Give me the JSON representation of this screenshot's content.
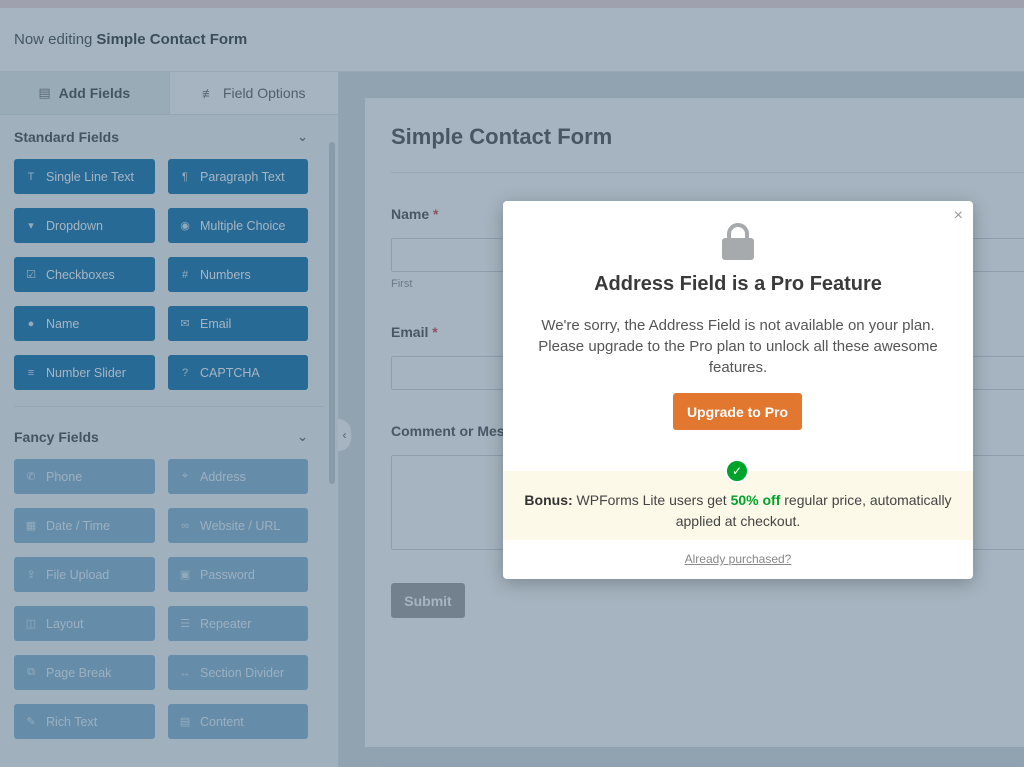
{
  "header": {
    "prefix": "Now editing",
    "form_name": "Simple Contact Form"
  },
  "tabs": [
    {
      "label": "Add Fields",
      "icon": "list-icon"
    },
    {
      "label": "Field Options",
      "icon": "sliders-icon"
    }
  ],
  "standard": {
    "title": "Standard Fields",
    "items": [
      {
        "label": "Single Line Text",
        "icon": "text-icon",
        "glyph": "T"
      },
      {
        "label": "Paragraph Text",
        "icon": "paragraph-icon",
        "glyph": "¶"
      },
      {
        "label": "Dropdown",
        "icon": "dropdown-icon",
        "glyph": "▾"
      },
      {
        "label": "Multiple Choice",
        "icon": "radio-icon",
        "glyph": "◉"
      },
      {
        "label": "Checkboxes",
        "icon": "checkbox-icon",
        "glyph": "☑"
      },
      {
        "label": "Numbers",
        "icon": "hash-icon",
        "glyph": "#"
      },
      {
        "label": "Name",
        "icon": "user-icon",
        "glyph": "●"
      },
      {
        "label": "Email",
        "icon": "envelope-icon",
        "glyph": "✉"
      },
      {
        "label": "Number Slider",
        "icon": "sliders-icon",
        "glyph": "≡"
      },
      {
        "label": "CAPTCHA",
        "icon": "question-icon",
        "glyph": "?"
      }
    ]
  },
  "fancy": {
    "title": "Fancy Fields",
    "items": [
      {
        "label": "Phone",
        "icon": "phone-icon",
        "glyph": "✆"
      },
      {
        "label": "Address",
        "icon": "map-pin-icon",
        "glyph": "⌖"
      },
      {
        "label": "Date / Time",
        "icon": "calendar-icon",
        "glyph": "▦"
      },
      {
        "label": "Website / URL",
        "icon": "link-icon",
        "glyph": "∞"
      },
      {
        "label": "File Upload",
        "icon": "upload-icon",
        "glyph": "⇪"
      },
      {
        "label": "Password",
        "icon": "lock-icon",
        "glyph": "▣"
      },
      {
        "label": "Layout",
        "icon": "columns-icon",
        "glyph": "◫"
      },
      {
        "label": "Repeater",
        "icon": "list-icon",
        "glyph": "☰"
      },
      {
        "label": "Page Break",
        "icon": "copy-icon",
        "glyph": "⧉"
      },
      {
        "label": "Section Divider",
        "icon": "arrows-h-icon",
        "glyph": "↔"
      },
      {
        "label": "Rich Text",
        "icon": "edit-icon",
        "glyph": "✎"
      },
      {
        "label": "Content",
        "icon": "file-icon",
        "glyph": "▤"
      }
    ]
  },
  "form": {
    "title": "Simple Contact Form",
    "name_label": "Name",
    "first_sub": "First",
    "email_label": "Email",
    "required_mark": "*",
    "comment_label": "Comment or Mes",
    "submit_label": "Submit"
  },
  "modal": {
    "close": "×",
    "title": "Address Field is a Pro Feature",
    "text": "We're sorry, the Address Field is not available on your plan. Please upgrade to the Pro plan to unlock all these awesome features.",
    "upgrade_label": "Upgrade to Pro",
    "bonus_label": "Bonus:",
    "bonus_pre": "WPForms Lite users get",
    "bonus_highlight": "50% off",
    "bonus_post": "regular price, automatically applied at checkout.",
    "already_label": "Already purchased?"
  },
  "colors": {
    "field_button": "#036aab",
    "upgrade": "#e27730",
    "bonus_green": "#00a32a"
  }
}
